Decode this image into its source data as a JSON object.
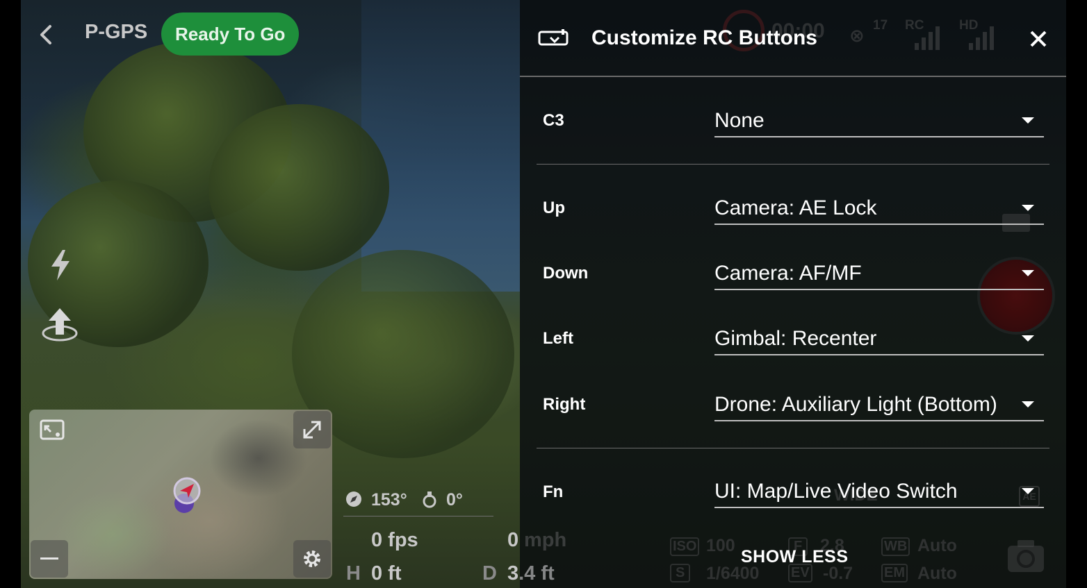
{
  "top_bar": {
    "flight_mode": "P-GPS",
    "status": "Ready To Go",
    "status_color": "#1e8f3b",
    "satellites": "17",
    "rc_label": "RC",
    "hd_label": "HD",
    "timer": "00:00"
  },
  "left_icons": [
    "back-arrow-icon",
    "lightning-icon",
    "takeoff-icon"
  ],
  "minimap": {
    "buttons": [
      "switch-view-icon",
      "expand-icon",
      "minus-icon",
      "gear-icon"
    ]
  },
  "telemetry": {
    "heading": "153°",
    "gimbal": "0°",
    "fps": "0 fps",
    "speed": "0",
    "speed_unit": "mph",
    "height_label": "H",
    "height": "0 ft",
    "distance_label": "D",
    "distance": "3.4 ft"
  },
  "camera_settings": {
    "iso_label": "ISO",
    "iso": "100",
    "f_label": "F",
    "f": "2.8",
    "wb_label": "WB",
    "wb": "Auto",
    "s_label": "S",
    "shutter": "1/6400",
    "ev_label": "EV",
    "ev": "-0.7",
    "em_label": "EM",
    "em": "Auto",
    "lens": "WIDE",
    "ae": "AE"
  },
  "panel": {
    "title": "Customize RC Buttons",
    "rows": [
      {
        "label": "C3",
        "value": "None"
      },
      {
        "label": "Up",
        "value": "Camera: AE Lock"
      },
      {
        "label": "Down",
        "value": "Camera: AF/MF"
      },
      {
        "label": "Left",
        "value": "Gimbal: Recenter"
      },
      {
        "label": "Right",
        "value": "Drone: Auxiliary Light (Bottom)"
      },
      {
        "label": "Fn",
        "value": "UI: Map/Live Video Switch"
      }
    ],
    "show_less": "SHOW LESS"
  },
  "colors": {
    "record": "#6a0e0e",
    "accent_green": "#1e8f3b"
  }
}
